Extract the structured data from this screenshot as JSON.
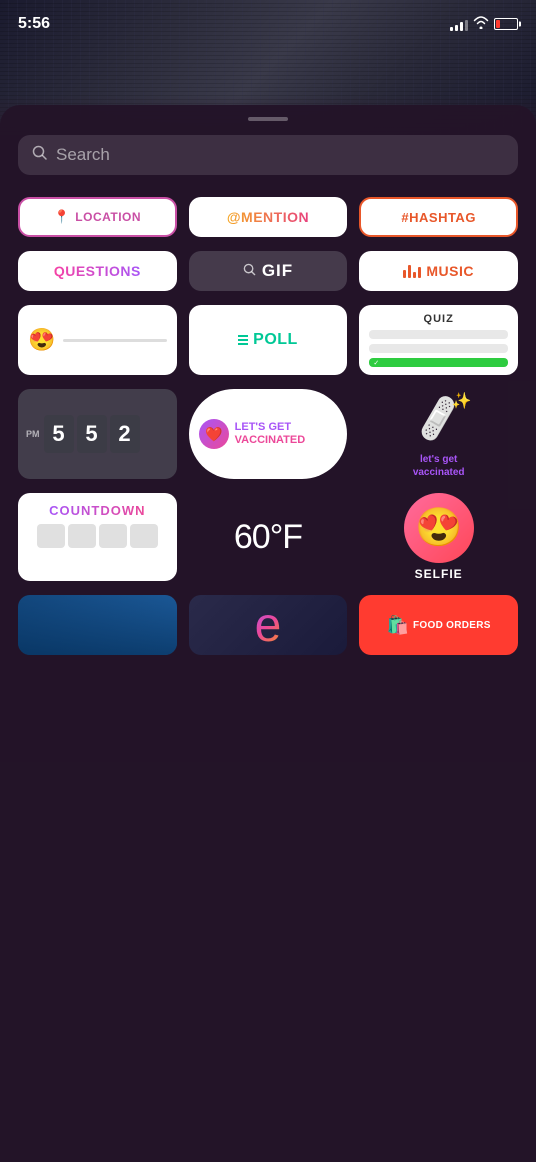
{
  "statusBar": {
    "time": "5:56",
    "batteryColor": "#ff3b30"
  },
  "search": {
    "placeholder": "Search"
  },
  "stickers": {
    "row1": [
      {
        "id": "location",
        "label": "LOCATION",
        "icon": "📍"
      },
      {
        "id": "mention",
        "label": "@MENTION"
      },
      {
        "id": "hashtag",
        "label": "#HASHTAG"
      }
    ],
    "row2": [
      {
        "id": "questions",
        "label": "QUESTIONS"
      },
      {
        "id": "gif",
        "label": "GIF"
      },
      {
        "id": "music",
        "label": "MUSIC"
      }
    ],
    "row3": [
      {
        "id": "emoji-slider",
        "emoji": "😍"
      },
      {
        "id": "poll",
        "label": "POLL"
      },
      {
        "id": "quiz",
        "label": "QUIZ"
      }
    ],
    "row4": [
      {
        "id": "clock",
        "time": "5 5 2",
        "period": "PM"
      },
      {
        "id": "vaccinated",
        "line1": "LET'S GET",
        "line2": "VACCINATED"
      },
      {
        "id": "bandage",
        "label": "let's get\nvaccinated"
      }
    ],
    "row5": [
      {
        "id": "countdown",
        "label": "COUNTDOWN"
      },
      {
        "id": "weather",
        "label": "60°F"
      },
      {
        "id": "selfie",
        "label": "SELFIE"
      }
    ],
    "row6": [
      {
        "id": "location-thumb"
      },
      {
        "id": "e-sticker"
      },
      {
        "id": "food-orders",
        "label": "FOOD ORDERS"
      }
    ]
  }
}
